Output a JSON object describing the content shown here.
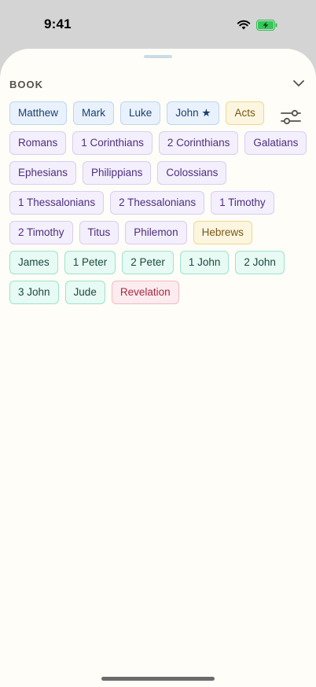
{
  "status": {
    "time": "9:41"
  },
  "section": {
    "title": "BOOK"
  },
  "colors": {
    "blue": "#e9f2fc",
    "gold": "#fcf6e1",
    "purple": "#f4effc",
    "teal": "#e7faf4",
    "red": "#fcecef",
    "sheet": "#fefdf7"
  },
  "rows": [
    [
      {
        "label": "Matthew",
        "color": "blue"
      },
      {
        "label": "Mark",
        "color": "blue"
      },
      {
        "label": "Luke",
        "color": "blue"
      },
      {
        "label": "John ★",
        "color": "blue"
      },
      {
        "label": "Acts",
        "color": "gold"
      }
    ],
    [
      {
        "label": "Romans",
        "color": "purple"
      },
      {
        "label": "1 Corinthians",
        "color": "purple"
      },
      {
        "label": "2 Corinthians",
        "color": "purple"
      },
      {
        "label": "Galatians",
        "color": "purple"
      }
    ],
    [
      {
        "label": "Ephesians",
        "color": "purple"
      },
      {
        "label": "Philippians",
        "color": "purple"
      },
      {
        "label": "Colossians",
        "color": "purple"
      }
    ],
    [
      {
        "label": "1 Thessalonians",
        "color": "purple"
      },
      {
        "label": "2 Thessalonians",
        "color": "purple"
      },
      {
        "label": "1 Timothy",
        "color": "purple"
      }
    ],
    [
      {
        "label": "2 Timothy",
        "color": "purple"
      },
      {
        "label": "Titus",
        "color": "purple"
      },
      {
        "label": "Philemon",
        "color": "purple"
      },
      {
        "label": "Hebrews",
        "color": "gold"
      }
    ],
    [
      {
        "label": "James",
        "color": "teal"
      },
      {
        "label": "1 Peter",
        "color": "teal"
      },
      {
        "label": "2 Peter",
        "color": "teal"
      },
      {
        "label": "1 John",
        "color": "teal"
      },
      {
        "label": "2 John",
        "color": "teal"
      }
    ],
    [
      {
        "label": "3 John",
        "color": "teal"
      },
      {
        "label": "Jude",
        "color": "teal"
      },
      {
        "label": "Revelation",
        "color": "red"
      }
    ]
  ],
  "icons": {
    "wifi": "wifi-icon",
    "battery": "battery-charging-icon",
    "collapse": "chevron-down-icon",
    "filter": "sliders-icon"
  }
}
